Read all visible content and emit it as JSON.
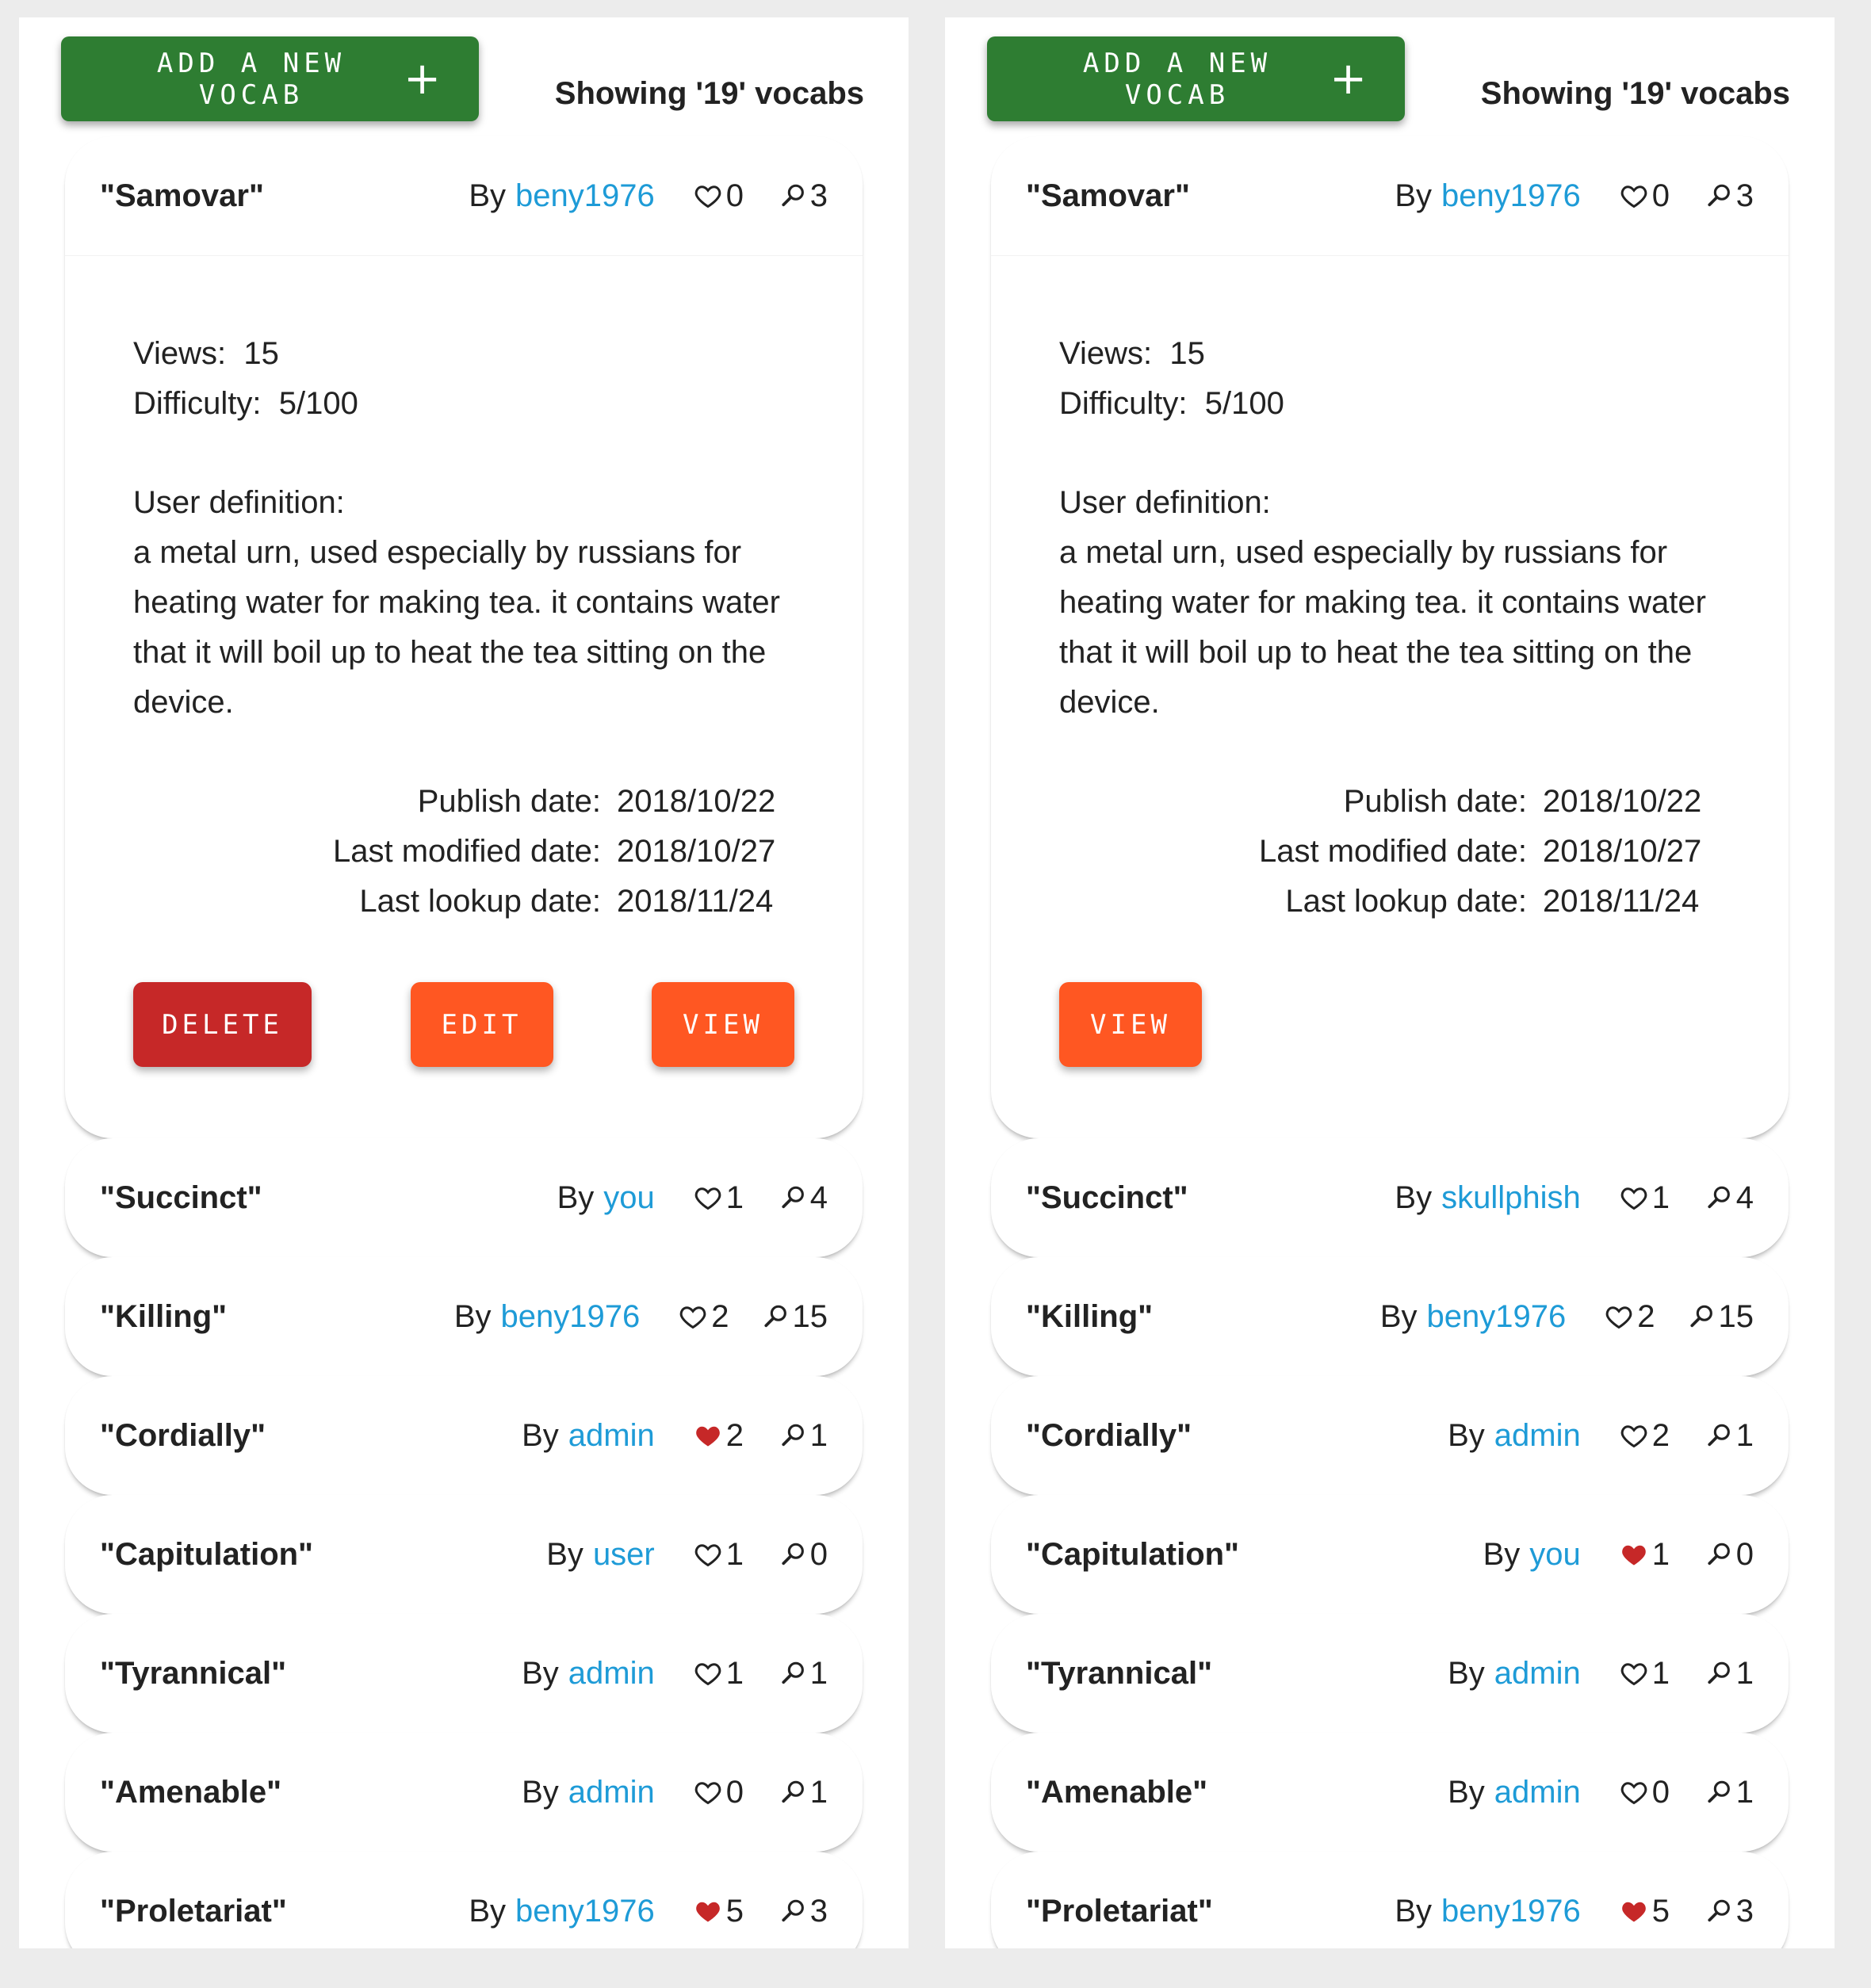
{
  "colors": {
    "primary_green": "#2e7d32",
    "delete_red": "#c62828",
    "action_orange": "#ff5722",
    "link_blue": "#1e9bd7",
    "liked_red": "#c62828"
  },
  "common": {
    "add_button": "ADD A NEW VOCAB",
    "plus": "+",
    "by": "By",
    "views_label": "Views:",
    "difficulty_label": "Difficulty:",
    "definition_label": "User definition:",
    "publish_label": "Publish date:",
    "modified_label": "Last modified date:",
    "lookup_label": "Last lookup date:",
    "delete_label": "DELETE",
    "edit_label": "EDIT",
    "view_label": "VIEW"
  },
  "left": {
    "showing": "Showing '19' vocabs",
    "expanded": {
      "word": "\"Samovar\"",
      "author": "beny1976",
      "likes": "0",
      "liked": false,
      "lookups": "3",
      "views": "15",
      "difficulty": "5/100",
      "definition": "a metal urn, used especially by russians for heating water for making tea. it contains water that it will boil up to heat the tea sitting on the device.",
      "publish_date": "2018/10/22",
      "modified_date": "2018/10/27",
      "lookup_date": "2018/11/24"
    },
    "items": [
      {
        "word": "\"Succinct\"",
        "author": "you",
        "likes": "1",
        "liked": false,
        "lookups": "4"
      },
      {
        "word": "\"Killing\"",
        "author": "beny1976",
        "likes": "2",
        "liked": false,
        "lookups": "15"
      },
      {
        "word": "\"Cordially\"",
        "author": "admin",
        "likes": "2",
        "liked": true,
        "lookups": "1"
      },
      {
        "word": "\"Capitulation\"",
        "author": "user",
        "likes": "1",
        "liked": false,
        "lookups": "0"
      },
      {
        "word": "\"Tyrannical\"",
        "author": "admin",
        "likes": "1",
        "liked": false,
        "lookups": "1"
      },
      {
        "word": "\"Amenable\"",
        "author": "admin",
        "likes": "0",
        "liked": false,
        "lookups": "1"
      },
      {
        "word": "\"Proletariat\"",
        "author": "beny1976",
        "likes": "5",
        "liked": true,
        "lookups": "3"
      }
    ]
  },
  "right": {
    "showing": "Showing '19' vocabs",
    "expanded": {
      "word": "\"Samovar\"",
      "author": "beny1976",
      "likes": "0",
      "liked": false,
      "lookups": "3",
      "views": "15",
      "difficulty": "5/100",
      "definition": "a metal urn, used especially by russians for heating water for making tea. it contains water that it will boil up to heat the tea sitting on the device.",
      "publish_date": "2018/10/22",
      "modified_date": "2018/10/27",
      "lookup_date": "2018/11/24"
    },
    "items": [
      {
        "word": "\"Succinct\"",
        "author": "skullphish",
        "likes": "1",
        "liked": false,
        "lookups": "4"
      },
      {
        "word": "\"Killing\"",
        "author": "beny1976",
        "likes": "2",
        "liked": false,
        "lookups": "15"
      },
      {
        "word": "\"Cordially\"",
        "author": "admin",
        "likes": "2",
        "liked": false,
        "lookups": "1"
      },
      {
        "word": "\"Capitulation\"",
        "author": "you",
        "likes": "1",
        "liked": true,
        "lookups": "0"
      },
      {
        "word": "\"Tyrannical\"",
        "author": "admin",
        "likes": "1",
        "liked": false,
        "lookups": "1"
      },
      {
        "word": "\"Amenable\"",
        "author": "admin",
        "likes": "0",
        "liked": false,
        "lookups": "1"
      },
      {
        "word": "\"Proletariat\"",
        "author": "beny1976",
        "likes": "5",
        "liked": true,
        "lookups": "3"
      }
    ]
  }
}
